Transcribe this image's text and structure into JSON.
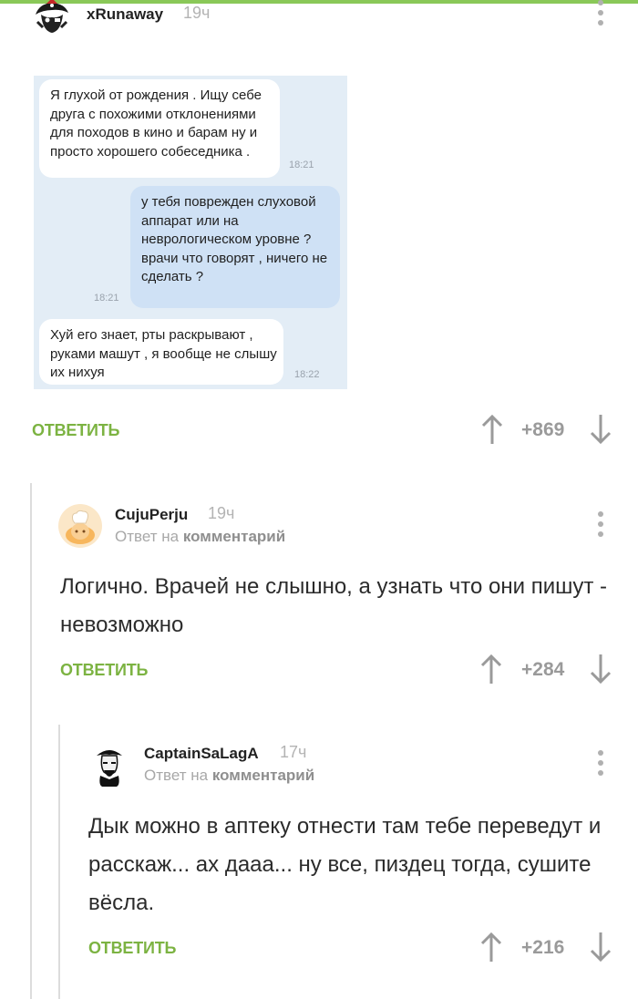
{
  "post": {
    "author": "xRunaway",
    "time": "19ч",
    "chat": {
      "messages": [
        {
          "text": "Я глухой от рождения . Ищу себе друга с похожими отклонениями для походов в кино и барам ну и просто хорошего собеседника .",
          "time": "18:21",
          "side": "in"
        },
        {
          "text": "у тебя поврежден слуховой аппарат или на неврологическом уровне ? врачи что говорят , ничего не сделать ?",
          "time": "18:21",
          "side": "out"
        },
        {
          "text": "Хуй его знает, рты раскрывают , руками машут , я вообще не слышу их нихуя",
          "time": "18:22",
          "side": "in"
        }
      ]
    },
    "reply_label": "ОТВЕТИТЬ",
    "score": "+869"
  },
  "comments": [
    {
      "author": "CujuPerju",
      "time": "19ч",
      "reply_prefix": "Ответ на",
      "reply_target": "комментарий",
      "text": "Логично. Врачей не слышно, а узнать что они пишут - невозможно",
      "reply_label": "ОТВЕТИТЬ",
      "score": "+284"
    },
    {
      "author": "CaptainSaLagA",
      "time": "17ч",
      "reply_prefix": "Ответ на",
      "reply_target": "комментарий",
      "text": "Дык можно в аптеку отнести там тебе переведут и расскаж... ах дааа... ну все, пиздец тогда, сушите вёсла.",
      "reply_label": "ОТВЕТИТЬ",
      "score": "+216"
    }
  ],
  "colors": {
    "accent_green": "#7cb342",
    "score_gray": "#9a9a9a",
    "thread_line": "#dcdcdc"
  },
  "icons": [
    "more-vertical-icon",
    "arrow-up-icon",
    "arrow-down-icon"
  ]
}
